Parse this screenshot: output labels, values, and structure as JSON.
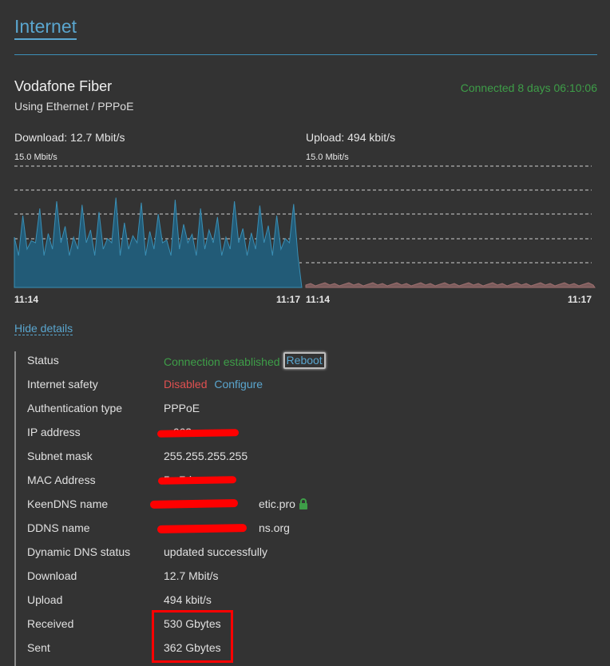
{
  "header": {
    "title": "Internet"
  },
  "connection": {
    "name": "Vodafone Fiber",
    "subtitle": "Using Ethernet / PPPoE",
    "status_time": "Connected 8 days 06:10:06"
  },
  "graphs": {
    "download": {
      "label": "Download: 12.7 Mbit/s",
      "scale": "15.0 Mbit/s",
      "start": "11:14",
      "end": "11:17"
    },
    "upload": {
      "label": "Upload: 494 kbit/s",
      "scale": "15.0 Mbit/s",
      "start": "11:14",
      "end": "11:17"
    }
  },
  "colors": {
    "accent": "#5aa6cf",
    "ok": "#3e9e48",
    "error": "#e05050",
    "download_fill": "#225b77",
    "upload_fill": "#7a5c5c"
  },
  "hide_details": "Hide details",
  "details": {
    "status": {
      "label": "Status",
      "value": "Connection established",
      "action": "Reboot"
    },
    "internet_safety": {
      "label": "Internet safety",
      "value": "Disabled",
      "action": "Configure"
    },
    "auth_type": {
      "label": "Authentication type",
      "value": "PPPoE"
    },
    "ip": {
      "label": "IP address",
      "value": "...663"
    },
    "subnet": {
      "label": "Subnet mask",
      "value": "255.255.255.255"
    },
    "mac": {
      "label": "MAC Address",
      "value": "5...7d"
    },
    "keendns": {
      "label": "KeenDNS name",
      "value": "etic.pro"
    },
    "ddns": {
      "label": "DDNS name",
      "value": "ns.org"
    },
    "ddns_status": {
      "label": "Dynamic DNS status",
      "value": "updated successfully"
    },
    "download": {
      "label": "Download",
      "value": "12.7 Mbit/s"
    },
    "upload": {
      "label": "Upload",
      "value": "494 kbit/s"
    },
    "received": {
      "label": "Received",
      "value": "530 Gbytes"
    },
    "sent": {
      "label": "Sent",
      "value": "362 Gbytes"
    }
  }
}
